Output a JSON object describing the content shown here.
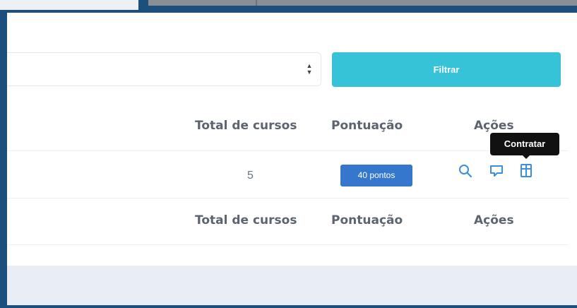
{
  "filter": {
    "button_label": "Filtrar"
  },
  "table": {
    "headers": {
      "total": "Total de cursos",
      "score": "Pontuação",
      "actions": "Ações"
    },
    "row": {
      "total": "5",
      "score_badge": "40 pontos"
    },
    "footer_headers": {
      "total": "Total de cursos",
      "score": "Pontuação",
      "actions": "Ações"
    }
  },
  "actions": {
    "icons": [
      "search-icon",
      "comment-icon",
      "contract-icon"
    ],
    "tooltip": "Contratar"
  },
  "colors": {
    "accent": "#36c3d8",
    "badge": "#3477cc",
    "icon": "#3a8fdc",
    "frame": "#1d4f7c"
  }
}
